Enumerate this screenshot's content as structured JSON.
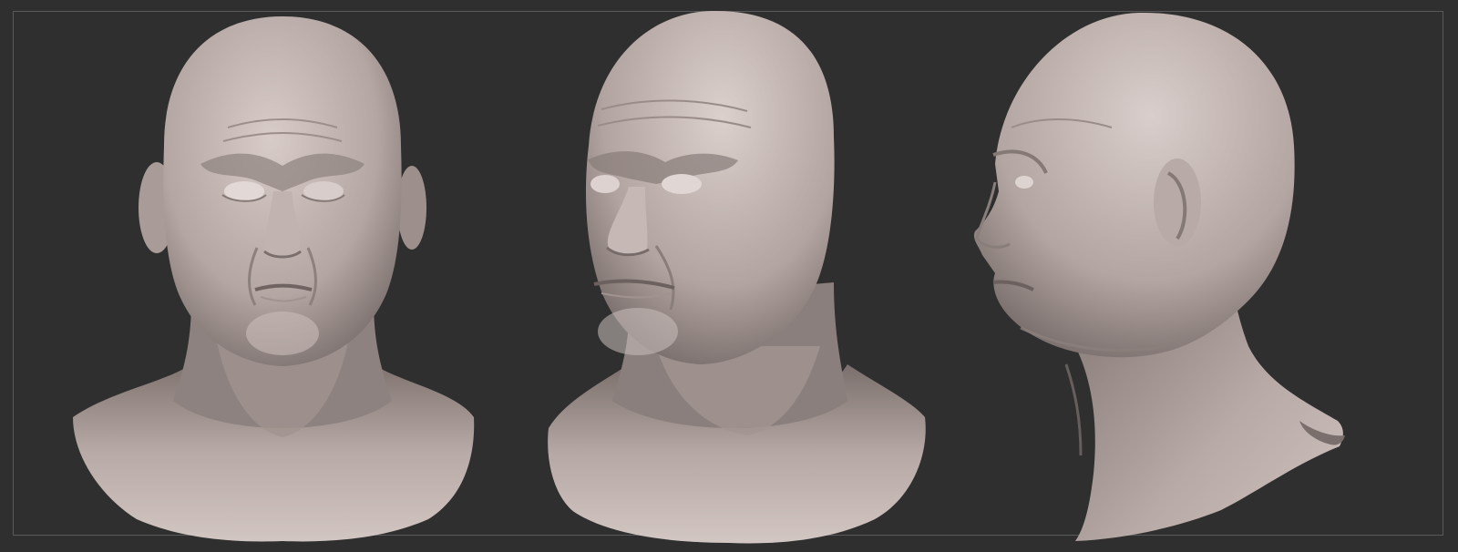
{
  "scene": {
    "background_color": "#2f2f30",
    "frame_color": "#5a5a5c",
    "material_color": "#cdbfbb"
  },
  "renders": [
    {
      "view": "front",
      "icon": "sculpt-bust-front"
    },
    {
      "view": "three-quarter",
      "icon": "sculpt-bust-three-quarter"
    },
    {
      "view": "profile",
      "icon": "sculpt-bust-profile"
    }
  ]
}
